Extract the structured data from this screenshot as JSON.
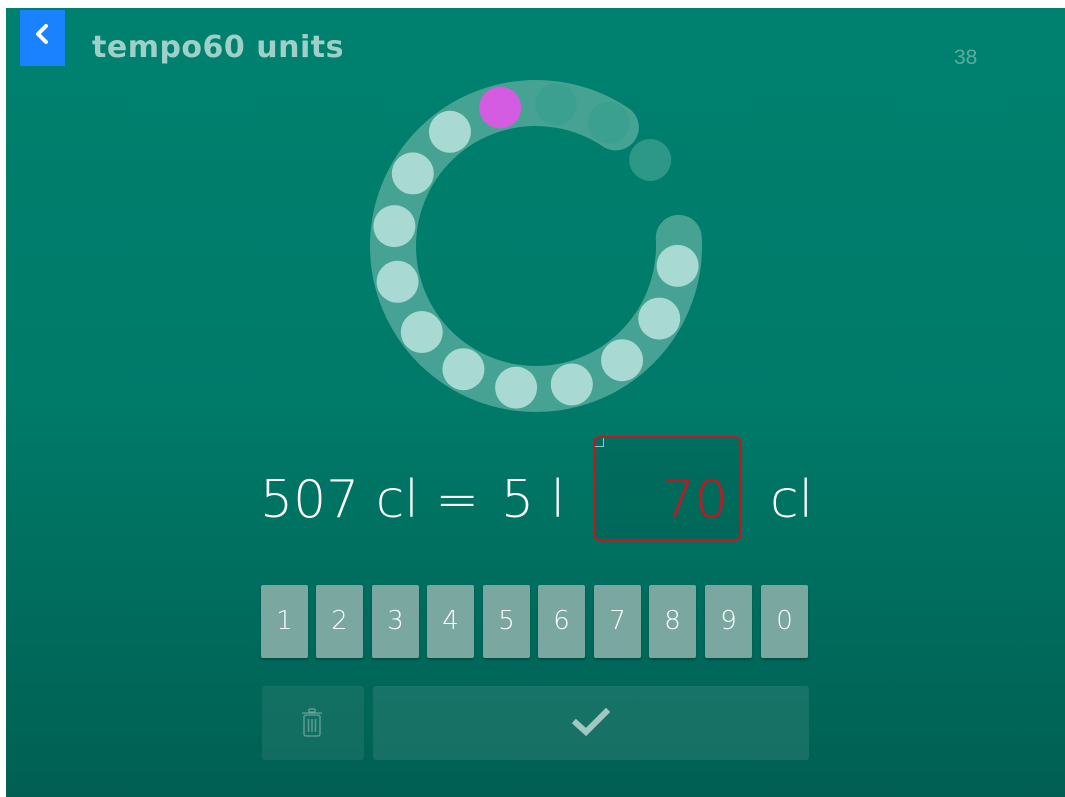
{
  "header": {
    "back_icon": "chevron-left-icon",
    "title": "tempo60 units",
    "counter": "38"
  },
  "progress": {
    "total_steps": 15,
    "completed_steps": 11,
    "current_step": 12,
    "colors": {
      "completed": "#a8d9d2",
      "current": "#d35ce0",
      "pending": "#3a9f8e",
      "track": "#52a99b"
    }
  },
  "equation": {
    "left_text": "507 cl =",
    "middle_text": "5 l",
    "answer_value": "70",
    "unit_text": "cl",
    "answer_color": "#c8161e"
  },
  "keypad": {
    "keys": [
      "1",
      "2",
      "3",
      "4",
      "5",
      "6",
      "7",
      "8",
      "9",
      "0"
    ]
  },
  "actions": {
    "delete_icon": "trash-icon",
    "submit_icon": "checkmark-icon"
  },
  "colors": {
    "background_top": "#00816f",
    "background_bottom": "#005f52",
    "back_button": "#1a82ff",
    "key_fill": "#7aa8a0"
  }
}
